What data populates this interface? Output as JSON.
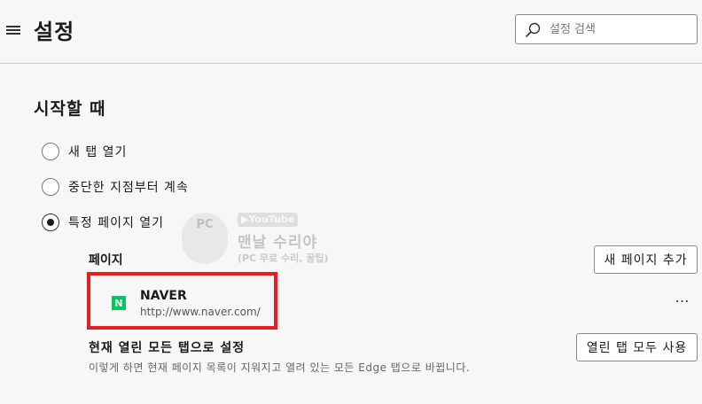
{
  "header": {
    "title": "설정",
    "search_placeholder": "설정 검색"
  },
  "startup": {
    "section_title": "시작할 때",
    "options": [
      {
        "label": "새 탭 열기",
        "checked": false
      },
      {
        "label": "중단한 지점부터 계속",
        "checked": false
      },
      {
        "label": "특정 페이지 열기",
        "checked": true
      }
    ],
    "pages_label": "페이지",
    "add_page_button": "새 페이지 추가",
    "pages": [
      {
        "name": "NAVER",
        "url": "http://www.naver.com/",
        "favicon_letter": "N",
        "favicon_color": "#03c75a"
      }
    ],
    "more_icon": "…",
    "set_current_title": "현재 열린 모든 탭으로 설정",
    "set_current_desc": "이렇게 하면 현재 페이지 목록이 지워지고 열려 있는 모든 Edge 탭으로 바뀝니다.",
    "use_open_tabs_button": "열린 탭 모두 사용"
  },
  "watermark": {
    "badge": "PC",
    "youtube": "▶YouTube",
    "main": "맨날 수리야",
    "sub": "(PC 무료 수리, 꿀팁)"
  },
  "colors": {
    "highlight": "#e41f1f",
    "background": "#f7f7f7"
  }
}
